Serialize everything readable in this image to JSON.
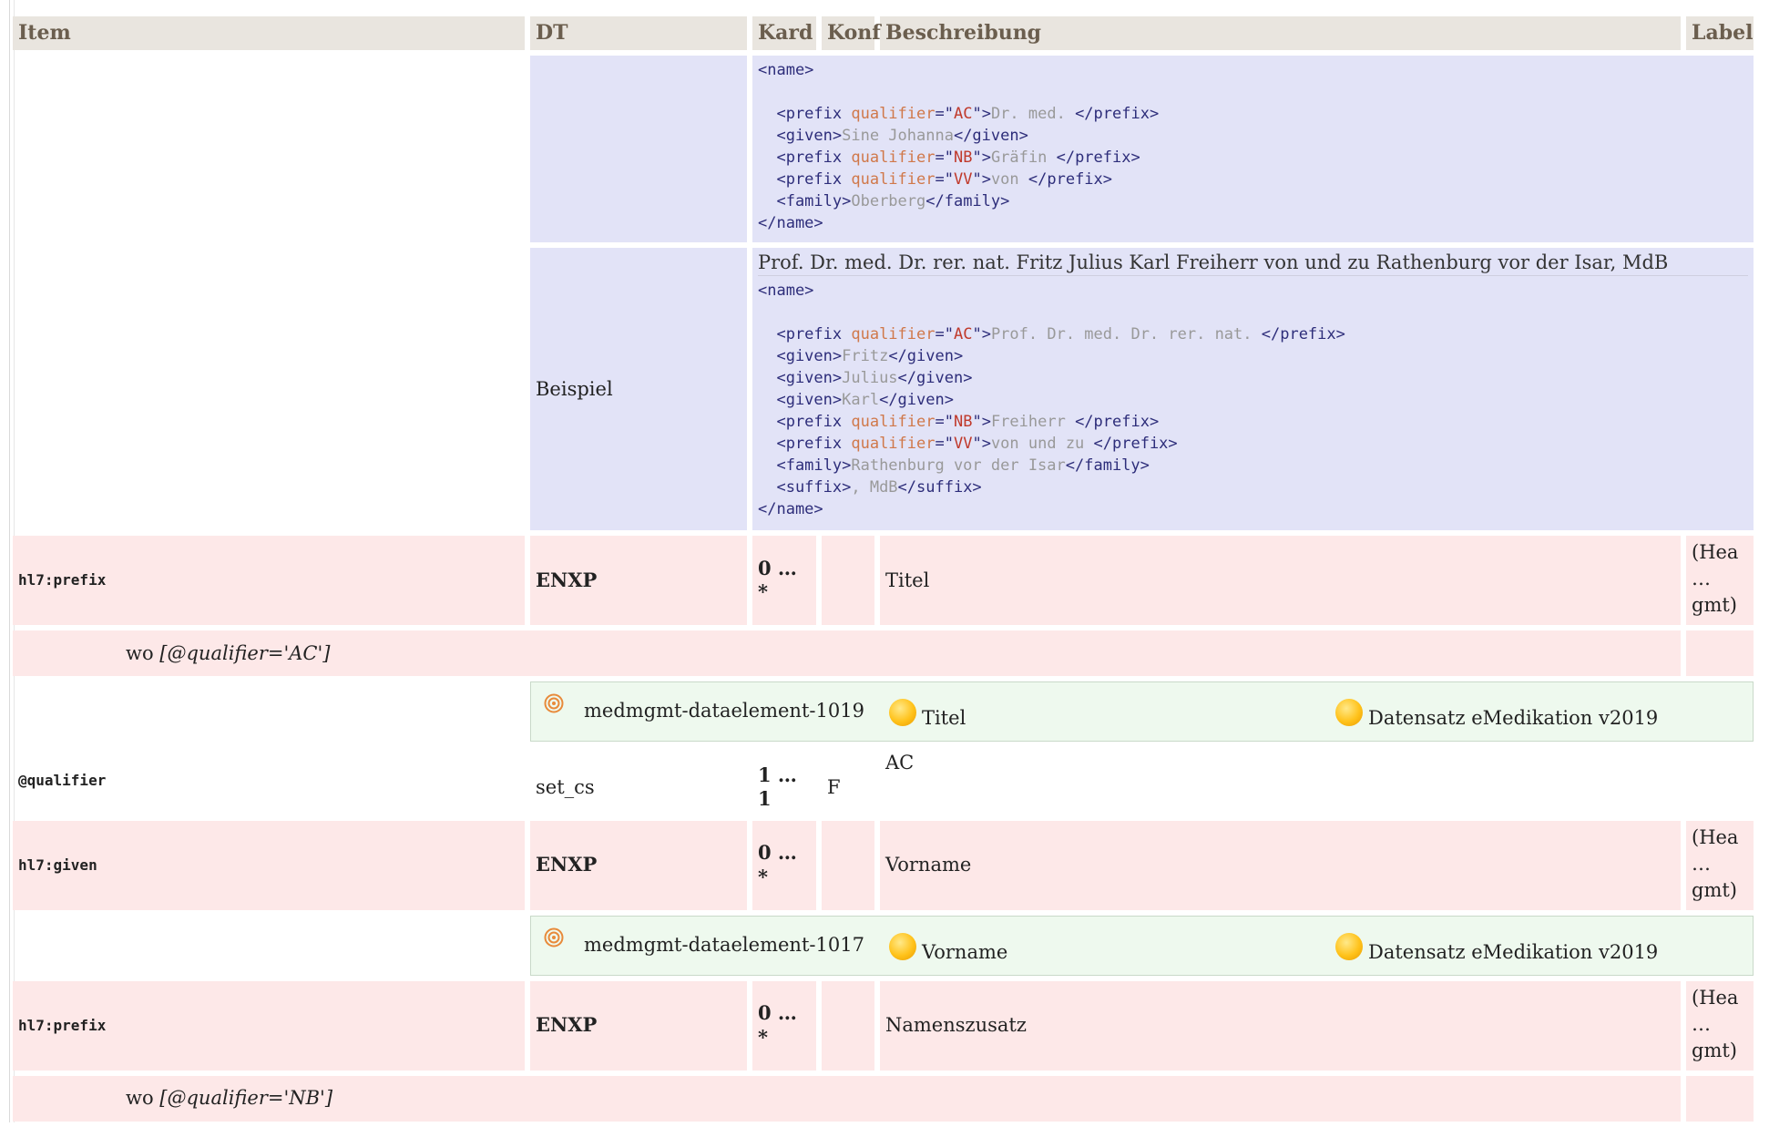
{
  "header": {
    "item": "Item",
    "dt": "DT",
    "kard": "Kard",
    "konf": "Konf",
    "beschreibung": "Beschreibung",
    "label": "Label"
  },
  "example1": {
    "lines": [
      [
        {
          "t": "tag",
          "v": "<name>"
        }
      ],
      [],
      [
        {
          "t": "tag",
          "v": "  <prefix "
        },
        {
          "t": "attr",
          "v": "qualifier"
        },
        {
          "t": "tag",
          "v": "=\""
        },
        {
          "t": "val",
          "v": "AC"
        },
        {
          "t": "tag",
          "v": "\">"
        },
        {
          "t": "txt",
          "v": "Dr. med. "
        },
        {
          "t": "tag",
          "v": "</prefix>"
        }
      ],
      [
        {
          "t": "tag",
          "v": "  <given>"
        },
        {
          "t": "txt",
          "v": "Sine Johanna"
        },
        {
          "t": "tag",
          "v": "</given>"
        }
      ],
      [
        {
          "t": "tag",
          "v": "  <prefix "
        },
        {
          "t": "attr",
          "v": "qualifier"
        },
        {
          "t": "tag",
          "v": "=\""
        },
        {
          "t": "val",
          "v": "NB"
        },
        {
          "t": "tag",
          "v": "\">"
        },
        {
          "t": "txt",
          "v": "Gräfin "
        },
        {
          "t": "tag",
          "v": "</prefix>"
        }
      ],
      [
        {
          "t": "tag",
          "v": "  <prefix "
        },
        {
          "t": "attr",
          "v": "qualifier"
        },
        {
          "t": "tag",
          "v": "=\""
        },
        {
          "t": "val",
          "v": "VV"
        },
        {
          "t": "tag",
          "v": "\">"
        },
        {
          "t": "txt",
          "v": "von "
        },
        {
          "t": "tag",
          "v": "</prefix>"
        }
      ],
      [
        {
          "t": "tag",
          "v": "  <family>"
        },
        {
          "t": "txt",
          "v": "Oberberg"
        },
        {
          "t": "tag",
          "v": "</family>"
        }
      ],
      [
        {
          "t": "tag",
          "v": "</name>"
        }
      ]
    ]
  },
  "example2": {
    "dt_label": "Beispiel",
    "title": "Prof. Dr. med. Dr. rer. nat. Fritz Julius Karl Freiherr von und zu Rathenburg vor der Isar, MdB",
    "lines": [
      [
        {
          "t": "tag",
          "v": "<name>"
        }
      ],
      [],
      [
        {
          "t": "tag",
          "v": "  <prefix "
        },
        {
          "t": "attr",
          "v": "qualifier"
        },
        {
          "t": "tag",
          "v": "=\""
        },
        {
          "t": "val",
          "v": "AC"
        },
        {
          "t": "tag",
          "v": "\">"
        },
        {
          "t": "txt",
          "v": "Prof. Dr. med. Dr. rer. nat. "
        },
        {
          "t": "tag",
          "v": "</prefix>"
        }
      ],
      [
        {
          "t": "tag",
          "v": "  <given>"
        },
        {
          "t": "txt",
          "v": "Fritz"
        },
        {
          "t": "tag",
          "v": "</given>"
        }
      ],
      [
        {
          "t": "tag",
          "v": "  <given>"
        },
        {
          "t": "txt",
          "v": "Julius"
        },
        {
          "t": "tag",
          "v": "</given>"
        }
      ],
      [
        {
          "t": "tag",
          "v": "  <given>"
        },
        {
          "t": "txt",
          "v": "Karl"
        },
        {
          "t": "tag",
          "v": "</given>"
        }
      ],
      [
        {
          "t": "tag",
          "v": "  <prefix "
        },
        {
          "t": "attr",
          "v": "qualifier"
        },
        {
          "t": "tag",
          "v": "=\""
        },
        {
          "t": "val",
          "v": "NB"
        },
        {
          "t": "tag",
          "v": "\">"
        },
        {
          "t": "txt",
          "v": "Freiherr "
        },
        {
          "t": "tag",
          "v": "</prefix>"
        }
      ],
      [
        {
          "t": "tag",
          "v": "  <prefix "
        },
        {
          "t": "attr",
          "v": "qualifier"
        },
        {
          "t": "tag",
          "v": "=\""
        },
        {
          "t": "val",
          "v": "VV"
        },
        {
          "t": "tag",
          "v": "\">"
        },
        {
          "t": "txt",
          "v": "von und zu "
        },
        {
          "t": "tag",
          "v": "</prefix>"
        }
      ],
      [
        {
          "t": "tag",
          "v": "  <family>"
        },
        {
          "t": "txt",
          "v": "Rathenburg vor der Isar"
        },
        {
          "t": "tag",
          "v": "</family>"
        }
      ],
      [
        {
          "t": "tag",
          "v": "  <suffix>"
        },
        {
          "t": "txt",
          "v": ", MdB"
        },
        {
          "t": "tag",
          "v": "</suffix>"
        }
      ],
      [
        {
          "t": "tag",
          "v": "</name>"
        }
      ]
    ]
  },
  "rows": {
    "prefix1": {
      "item": "hl7:prefix",
      "dt": "ENXP",
      "kard": "0 … *",
      "desc": "Titel",
      "label": "(Hea\n…\ngmt)",
      "wo_prefix": "wo ",
      "wo_expr": "[@qualifier='AC']"
    },
    "concept1": {
      "id": "medmgmt-dataelement-1019",
      "name": "Titel",
      "dataset": "Datensatz eMedikation v2019"
    },
    "qualifier": {
      "item": "@qualifier",
      "dt": "set_cs",
      "kard": "1 … 1",
      "konf": "F",
      "desc": "AC"
    },
    "given": {
      "item": "hl7:given",
      "dt": "ENXP",
      "kard": "0 … *",
      "desc": "Vorname",
      "label": "(Hea\n…\ngmt)"
    },
    "concept2": {
      "id": "medmgmt-dataelement-1017",
      "name": "Vorname",
      "dataset": "Datensatz eMedikation v2019"
    },
    "prefix2": {
      "item": "hl7:prefix",
      "dt": "ENXP",
      "kard": "0 … *",
      "desc": "Namenszusatz",
      "label": "(Hea\n…\ngmt)",
      "wo_prefix": "wo ",
      "wo_expr": "[@qualifier='NB']"
    }
  },
  "icons": {
    "target": "target-icon",
    "concept": "sun-icon"
  },
  "colors": {
    "header_bg": "#e9e5df",
    "example_bg": "#e2e3f7",
    "element_bg": "#fde8e8",
    "concept_bg": "#eef9ee"
  }
}
